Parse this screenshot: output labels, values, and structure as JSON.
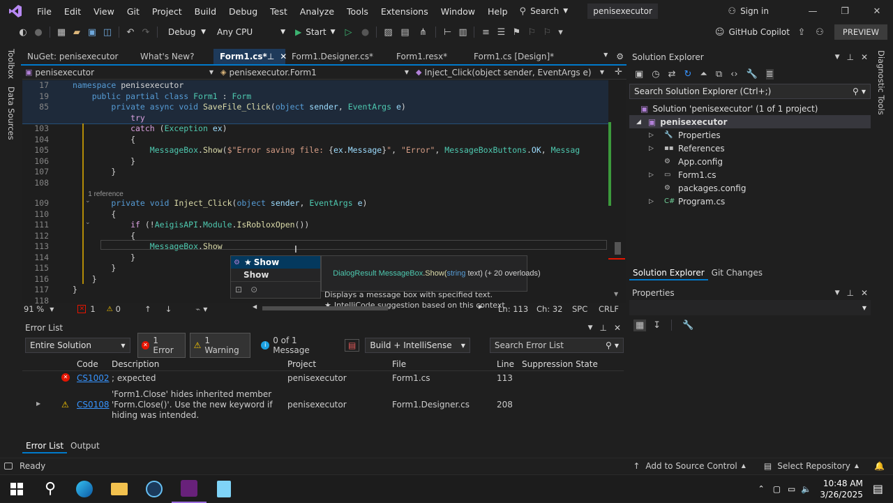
{
  "menu": {
    "items": [
      "File",
      "Edit",
      "View",
      "Git",
      "Project",
      "Build",
      "Debug",
      "Test",
      "Analyze",
      "Tools",
      "Extensions",
      "Window",
      "Help"
    ],
    "search": "Search",
    "solution_name": "penisexecutor",
    "sign_in": "Sign in"
  },
  "toolbar": {
    "config": "Debug",
    "platform": "Any CPU",
    "start": "Start",
    "copilot": "GitHub Copilot",
    "preview": "PREVIEW"
  },
  "side_tabs": {
    "toolbox": "Toolbox",
    "data_sources": "Data Sources",
    "diagnostic": "Diagnostic Tools"
  },
  "doc_tabs": [
    "NuGet: penisexecutor",
    "What's New?",
    "Form1.cs*",
    "Form1.Designer.cs*",
    "Form1.resx*",
    "Form1.cs [Design]*"
  ],
  "nav": {
    "project": "penisexecutor",
    "class": "penisexecutor.Form1",
    "member": "Inject_Click(object sender, EventArgs e)"
  },
  "code": {
    "sticky": [
      {
        "n": "17",
        "t": [
          [
            "kw",
            "namespace "
          ],
          [
            "nm",
            "penisexecutor"
          ]
        ]
      },
      {
        "n": "19",
        "t": [
          [
            "kw",
            "    public partial class "
          ],
          [
            "ty",
            "Form1"
          ],
          [
            "nm",
            " : "
          ],
          [
            "ty",
            "Form"
          ]
        ]
      },
      {
        "n": "85",
        "t": [
          [
            "kw",
            "        private async void "
          ],
          [
            "mt",
            "SaveFile_Click"
          ],
          [
            "nm",
            "("
          ],
          [
            "kw",
            "object "
          ],
          [
            "pm",
            "sender"
          ],
          [
            "nm",
            ", "
          ],
          [
            "ty",
            "EventArgs "
          ],
          [
            "pm",
            "e"
          ],
          [
            "nm",
            ")"
          ]
        ]
      },
      {
        "n": "",
        "t": [
          [
            "cf",
            "            try"
          ]
        ]
      }
    ],
    "lines": [
      {
        "n": "103",
        "t": [
          [
            "cf",
            "            catch "
          ],
          [
            "nm",
            "("
          ],
          [
            "ty",
            "Exception "
          ],
          [
            "pm",
            "ex"
          ],
          [
            "nm",
            ")"
          ]
        ]
      },
      {
        "n": "104",
        "t": [
          [
            "nm",
            "            {"
          ]
        ]
      },
      {
        "n": "105",
        "t": [
          [
            "nm",
            "                "
          ],
          [
            "ty",
            "MessageBox"
          ],
          [
            "nm",
            "."
          ],
          [
            "mt",
            "Show"
          ],
          [
            "nm",
            "("
          ],
          [
            "st",
            "$\"Error saving file: "
          ],
          [
            "nm",
            "{"
          ],
          [
            "pm",
            "ex"
          ],
          [
            "nm",
            "."
          ],
          [
            "pm",
            "Message"
          ],
          [
            "nm",
            "}"
          ],
          [
            "st",
            "\""
          ],
          [
            "nm",
            ", "
          ],
          [
            "st",
            "\"Error\""
          ],
          [
            "nm",
            ", "
          ],
          [
            "ty",
            "MessageBoxButtons"
          ],
          [
            "nm",
            "."
          ],
          [
            "pm",
            "OK"
          ],
          [
            "nm",
            ", "
          ],
          [
            "ty",
            "Messag"
          ]
        ]
      },
      {
        "n": "106",
        "t": [
          [
            "nm",
            "            }"
          ]
        ]
      },
      {
        "n": "107",
        "t": [
          [
            "nm",
            "        }"
          ]
        ]
      },
      {
        "n": "108",
        "t": [
          [
            "nm",
            ""
          ]
        ]
      },
      {
        "n": "",
        "t": [
          [
            "ref",
            "        1 reference"
          ]
        ]
      },
      {
        "n": "109",
        "t": [
          [
            "kw",
            "        private void "
          ],
          [
            "mt",
            "Inject_Click"
          ],
          [
            "nm",
            "("
          ],
          [
            "kw",
            "object "
          ],
          [
            "pm",
            "sender"
          ],
          [
            "nm",
            ", "
          ],
          [
            "ty",
            "EventArgs "
          ],
          [
            "pm",
            "e"
          ],
          [
            "nm",
            ")"
          ]
        ]
      },
      {
        "n": "110",
        "t": [
          [
            "nm",
            "        {"
          ]
        ]
      },
      {
        "n": "111",
        "t": [
          [
            "cf",
            "            if "
          ],
          [
            "nm",
            "(!"
          ],
          [
            "ty",
            "AeigisAPI"
          ],
          [
            "nm",
            "."
          ],
          [
            "ty",
            "Module"
          ],
          [
            "nm",
            "."
          ],
          [
            "mt",
            "IsRobloxOpen"
          ],
          [
            "nm",
            "())"
          ]
        ]
      },
      {
        "n": "112",
        "t": [
          [
            "nm",
            "            {"
          ]
        ]
      },
      {
        "n": "113",
        "t": [
          [
            "nm",
            "                "
          ],
          [
            "ty",
            "MessageBox"
          ],
          [
            "nm",
            "."
          ],
          [
            "mt",
            "Show"
          ]
        ]
      },
      {
        "n": "114",
        "t": [
          [
            "nm",
            "            }"
          ]
        ]
      },
      {
        "n": "115",
        "t": [
          [
            "nm",
            "        }"
          ]
        ]
      },
      {
        "n": "116",
        "t": [
          [
            "nm",
            "    }"
          ]
        ]
      },
      {
        "n": "117",
        "t": [
          [
            "nm",
            "}"
          ]
        ]
      },
      {
        "n": "118",
        "t": [
          [
            "nm",
            ""
          ]
        ]
      }
    ]
  },
  "intellisense": {
    "items": [
      "Show",
      "Show"
    ],
    "tip_return": "DialogResult ",
    "tip_class": "MessageBox",
    "tip_method": ".Show(",
    "tip_ptype": "string",
    "tip_pname": " text) (+ 20 overloads)",
    "tip_desc": "Displays a message box with specified text.",
    "tip_ai": "IntelliCode suggestion based on this context"
  },
  "editor_status": {
    "zoom": "91 %",
    "errors": "1",
    "warnings": "0",
    "ln": "Ln: 113",
    "ch": "Ch: 32",
    "spc": "SPC",
    "crlf": "CRLF"
  },
  "error_list": {
    "title": "Error List",
    "scope": "Entire Solution",
    "errors_btn": "1 Error",
    "warnings_btn": "1 Warning",
    "messages_btn": "0 of 1 Message",
    "build_filter": "Build + IntelliSense",
    "search": "Search Error List",
    "columns": [
      "Code",
      "Description",
      "Project",
      "File",
      "Line",
      "Suppression State"
    ],
    "rows": [
      {
        "code": "CS1002",
        "desc": "; expected",
        "project": "penisexecutor",
        "file": "Form1.cs",
        "line": "113"
      },
      {
        "code": "CS0108",
        "desc": "'Form1.Close' hides inherited member 'Form.Close()'. Use the new keyword if hiding was intended.",
        "project": "penisexecutor",
        "file": "Form1.Designer.cs",
        "line": "208"
      }
    ],
    "bottom_tabs": [
      "Error List",
      "Output"
    ]
  },
  "solution_explorer": {
    "title": "Solution Explorer",
    "search": "Search Solution Explorer (Ctrl+;)",
    "solution": "Solution 'penisexecutor' (1 of 1 project)",
    "project": "penisexecutor",
    "items": [
      "Properties",
      "References",
      "App.config",
      "Form1.cs",
      "packages.config",
      "Program.cs"
    ],
    "tabs": [
      "Solution Explorer",
      "Git Changes"
    ]
  },
  "properties": {
    "title": "Properties"
  },
  "status_bar": {
    "ready": "Ready",
    "source_control": "Add to Source Control",
    "repo": "Select Repository"
  },
  "taskbar": {
    "time": "10:48 AM",
    "date": "3/26/2025"
  },
  "colors": {
    "accent": "#007acc",
    "error": "#e51400",
    "warning": "#ffcc00",
    "vs_purple": "#68217a"
  }
}
